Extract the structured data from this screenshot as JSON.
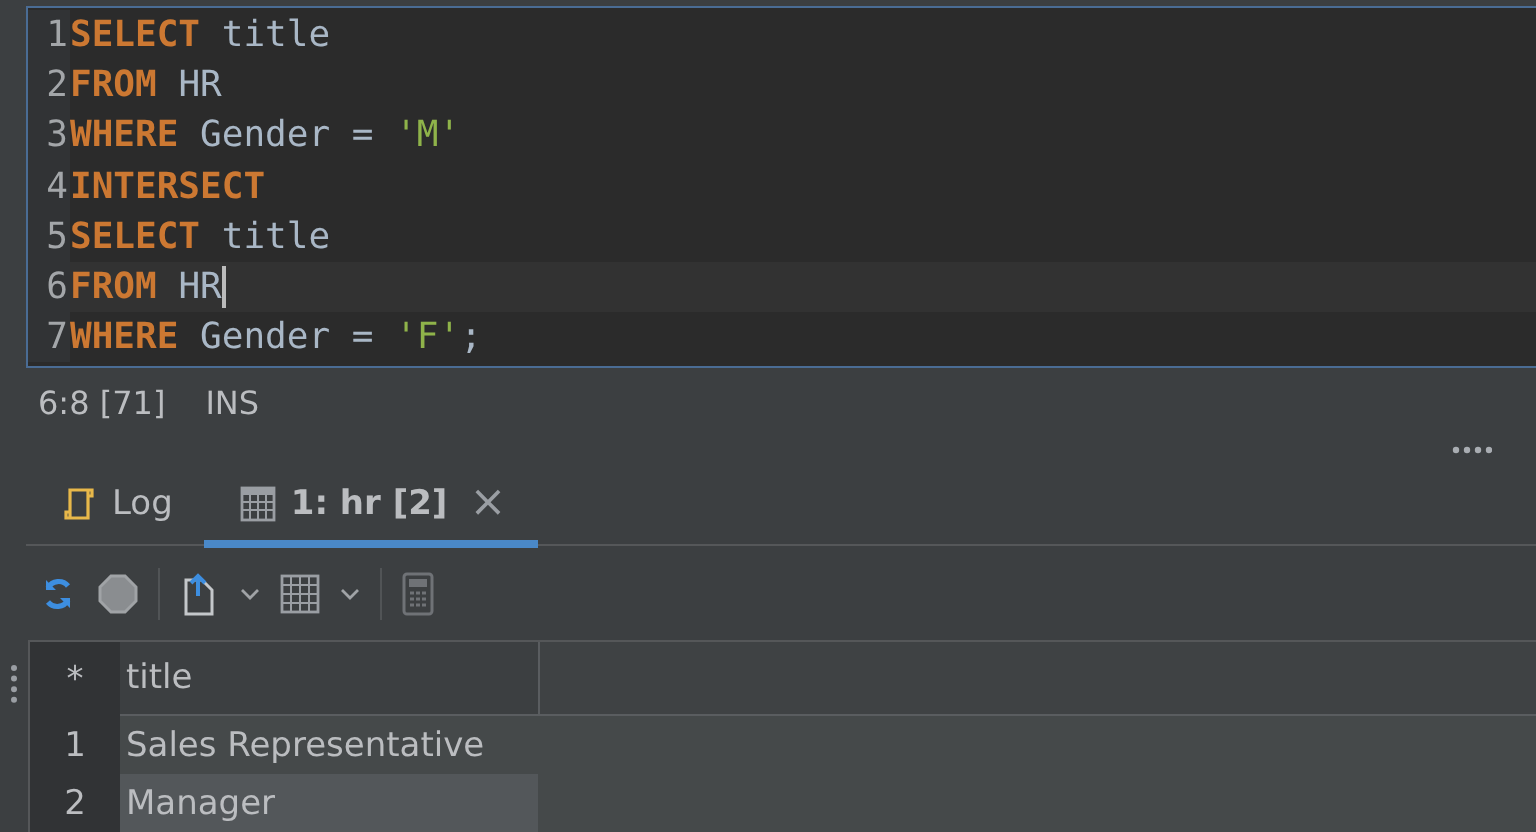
{
  "editor": {
    "lines": [
      {
        "number": "1",
        "current": false,
        "tokens": [
          {
            "kind": "keyword",
            "text": "SELECT"
          },
          {
            "kind": "plain",
            "text": " title"
          }
        ]
      },
      {
        "number": "2",
        "current": false,
        "tokens": [
          {
            "kind": "keyword",
            "text": "FROM"
          },
          {
            "kind": "plain",
            "text": " HR"
          }
        ]
      },
      {
        "number": "3",
        "current": false,
        "tokens": [
          {
            "kind": "keyword",
            "text": "WHERE"
          },
          {
            "kind": "plain",
            "text": " Gender = "
          },
          {
            "kind": "string",
            "text": "'M'"
          }
        ]
      },
      {
        "number": "4",
        "current": false,
        "tokens": [
          {
            "kind": "keyword",
            "text": "INTERSECT"
          }
        ]
      },
      {
        "number": "5",
        "current": false,
        "tokens": [
          {
            "kind": "keyword",
            "text": "SELECT"
          },
          {
            "kind": "plain",
            "text": " title"
          }
        ]
      },
      {
        "number": "6",
        "current": true,
        "tokens": [
          {
            "kind": "keyword",
            "text": "FROM"
          },
          {
            "kind": "plain",
            "text": " HR"
          }
        ]
      },
      {
        "number": "7",
        "current": false,
        "tokens": [
          {
            "kind": "keyword",
            "text": "WHERE"
          },
          {
            "kind": "plain",
            "text": " Gender = "
          },
          {
            "kind": "string",
            "text": "'F'"
          },
          {
            "kind": "plain",
            "text": ";"
          }
        ]
      }
    ]
  },
  "status_bar": {
    "position": "6:8 [71]",
    "mode": "INS"
  },
  "tabs": [
    {
      "label": "Log",
      "kind": "log",
      "selected": false,
      "closable": false
    },
    {
      "label": "1: hr [2]",
      "kind": "grid",
      "selected": true,
      "closable": true
    }
  ],
  "close_glyph": "×",
  "table": {
    "columns": [
      "*",
      "title"
    ],
    "rows": [
      {
        "number": "1",
        "title": "Sales Representative",
        "selected": false
      },
      {
        "number": "2",
        "title": "Manager",
        "selected": true
      }
    ]
  }
}
